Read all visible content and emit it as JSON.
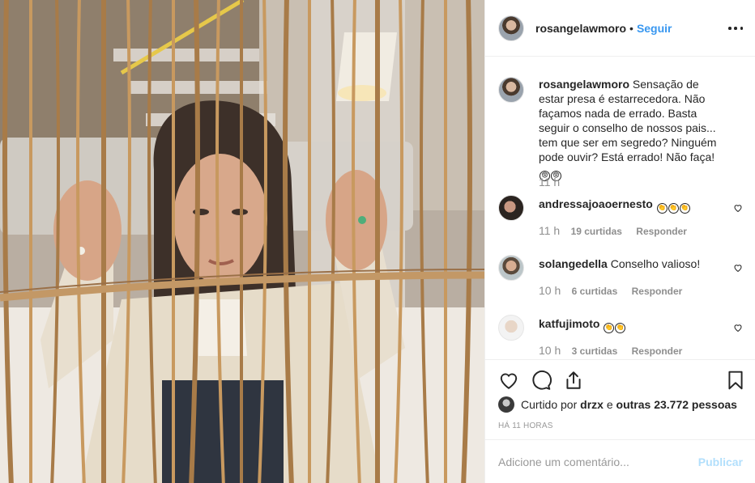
{
  "post": {
    "author": "rosangelawmoro",
    "dot": "•",
    "follow_label": "Seguir",
    "more_icon": "more-options-icon",
    "photo_alt": "Mulher segurando as barras de uma gaiola de madeira"
  },
  "caption": {
    "username": "rosangelawmoro",
    "text": "Sensação de estar presa é estarrecedora. Não façamos nada de errado. Basta seguir o conselho de nossos pais... tem que ser em segredo? Ninguém pode ouvir? Está errado! Não faça!",
    "emoji": [
      "😨",
      "😨"
    ],
    "time": "11 h"
  },
  "comments": [
    {
      "username": "andressajoaoernesto",
      "text": "",
      "emoji": [
        "👏",
        "👏",
        "👏"
      ],
      "time": "11 h",
      "likes": "19 curtidas",
      "reply": "Responder"
    },
    {
      "username": "solangedella",
      "text": "Conselho valioso!",
      "emoji": [],
      "time": "10 h",
      "likes": "6 curtidas",
      "reply": "Responder"
    },
    {
      "username": "katfujimoto",
      "text": "",
      "emoji": [
        "👏",
        "👏"
      ],
      "time": "10 h",
      "likes": "3 curtidas",
      "reply": "Responder"
    }
  ],
  "likes": {
    "prefix": "Curtido por",
    "user": "drzx",
    "middle": "e",
    "others": "outras 23.772 pessoas"
  },
  "posted_ago": "HÁ 11 HORAS",
  "add_comment": {
    "placeholder": "Adicione um comentário...",
    "publish_label": "Publicar"
  },
  "colors": {
    "link_blue": "#3897f0",
    "publish_disabled": "#b2dffc",
    "muted": "#8e8e8e",
    "text": "#262626",
    "border": "#efefef"
  }
}
